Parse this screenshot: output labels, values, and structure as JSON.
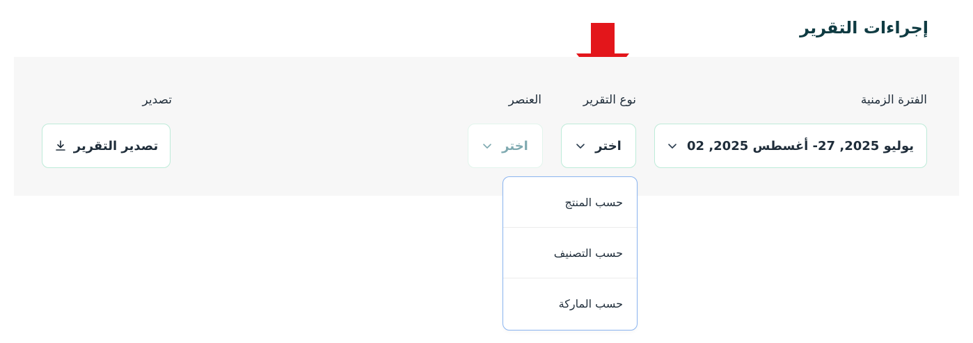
{
  "section": {
    "title": "إجراءات التقرير"
  },
  "filters": {
    "period": {
      "label": "الفترة الزمنية",
      "value": "يوليو 2025, 27- أغسطس 2025, 02"
    },
    "report_type": {
      "label": "نوع التقرير",
      "value": "اختر"
    },
    "element": {
      "label": "العنصر",
      "value": "اختر"
    },
    "export": {
      "label": "تصدير",
      "button": "تصدير التقرير"
    }
  },
  "dropdown": {
    "items": [
      {
        "label": "حسب المنتج"
      },
      {
        "label": "حسب التصنيف"
      },
      {
        "label": "حسب الماركة"
      }
    ]
  },
  "colors": {
    "title": "#0f3b42",
    "border": "#bdebd8",
    "dropdown_border": "#8ab4f0",
    "arrow": "#e3161b",
    "panel": "#f7f7f7"
  },
  "icons": [
    "chevron-down-icon",
    "download-icon",
    "red-arrow-annotation"
  ]
}
